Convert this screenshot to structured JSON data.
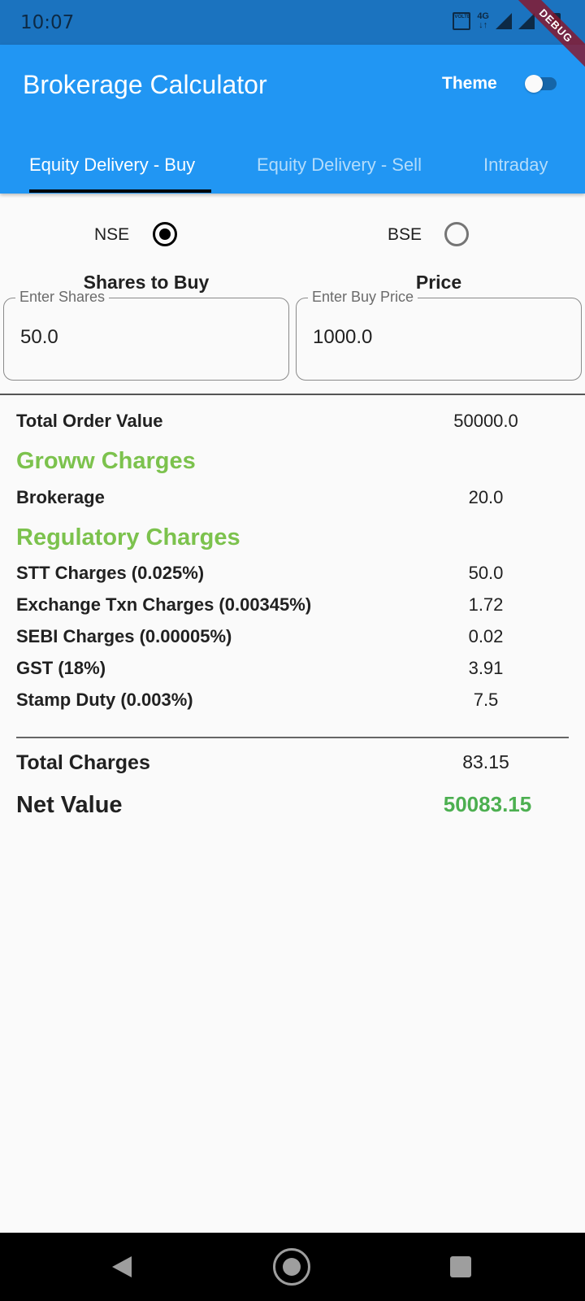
{
  "status_bar": {
    "time": "10:07",
    "volte_label": "VOLTE",
    "network_label": "4G"
  },
  "debug_banner": "DEBUG",
  "app_bar": {
    "title": "Brokerage Calculator",
    "theme_label": "Theme",
    "theme_toggle_on": false
  },
  "tabs": [
    {
      "label": "Equity Delivery - Buy",
      "active": true
    },
    {
      "label": "Equity Delivery - Sell",
      "active": false
    },
    {
      "label": "Intraday",
      "active": false
    }
  ],
  "exchange": {
    "options": [
      {
        "label": "NSE",
        "selected": true
      },
      {
        "label": "BSE",
        "selected": false
      }
    ]
  },
  "inputs": {
    "shares": {
      "title": "Shares to Buy",
      "label": "Enter Shares",
      "value": "50.0"
    },
    "price": {
      "title": "Price",
      "label": "Enter Buy Price",
      "value": "1000.0"
    }
  },
  "summary": {
    "total_order_value": {
      "label": "Total Order Value",
      "value": "50000.0"
    },
    "groww_section_title": "Groww Charges",
    "brokerage": {
      "label": "Brokerage",
      "value": "20.0"
    },
    "regulatory_section_title": "Regulatory Charges",
    "regulatory": [
      {
        "label": "STT Charges (0.025%)",
        "value": "50.0"
      },
      {
        "label": "Exchange Txn Charges (0.00345%)",
        "value": "1.72"
      },
      {
        "label": "SEBI Charges (0.00005%)",
        "value": "0.02"
      },
      {
        "label": "GST (18%)",
        "value": "3.91"
      },
      {
        "label": "Stamp Duty (0.003%)",
        "value": "7.5"
      }
    ],
    "total_charges": {
      "label": "Total Charges",
      "value": "83.15"
    },
    "net_value": {
      "label": "Net Value",
      "value": "50083.15"
    }
  },
  "colors": {
    "app_bar": "#2196f3",
    "status_bar": "#1b73bf",
    "section_title": "#7cc24d",
    "net_value": "#4caf50"
  }
}
